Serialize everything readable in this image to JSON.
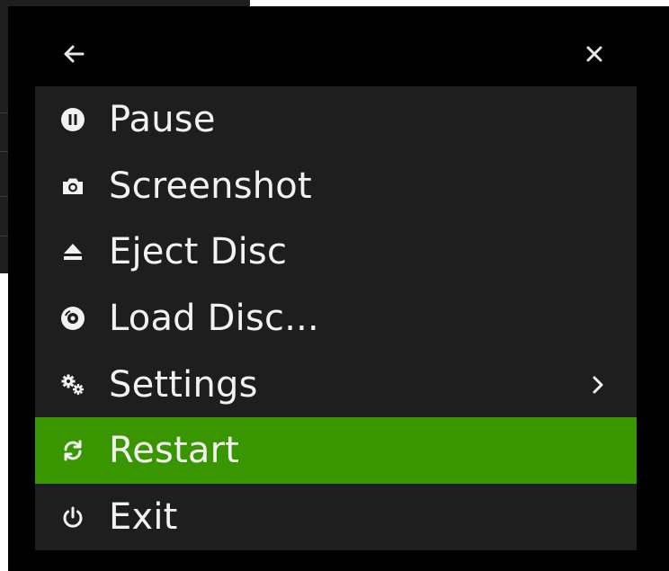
{
  "menu": {
    "items": [
      {
        "label": "Pause",
        "icon": "pause-icon",
        "selected": false
      },
      {
        "label": "Screenshot",
        "icon": "camera-icon",
        "selected": false
      },
      {
        "label": "Eject Disc",
        "icon": "eject-icon",
        "selected": false
      },
      {
        "label": "Load Disc...",
        "icon": "disc-icon",
        "selected": false
      },
      {
        "label": "Settings",
        "icon": "gears-icon",
        "selected": false,
        "has_submenu": true
      },
      {
        "label": "Restart",
        "icon": "restart-icon",
        "selected": true
      },
      {
        "label": "Exit",
        "icon": "power-icon",
        "selected": false
      }
    ]
  },
  "header": {
    "back_icon": "arrow-left-icon",
    "close_icon": "close-icon"
  },
  "colors": {
    "overlay_bg": "#000000",
    "menu_bg": "#1e1e1e",
    "selected_bg": "#3a9600",
    "text": "#f2f2f2"
  }
}
